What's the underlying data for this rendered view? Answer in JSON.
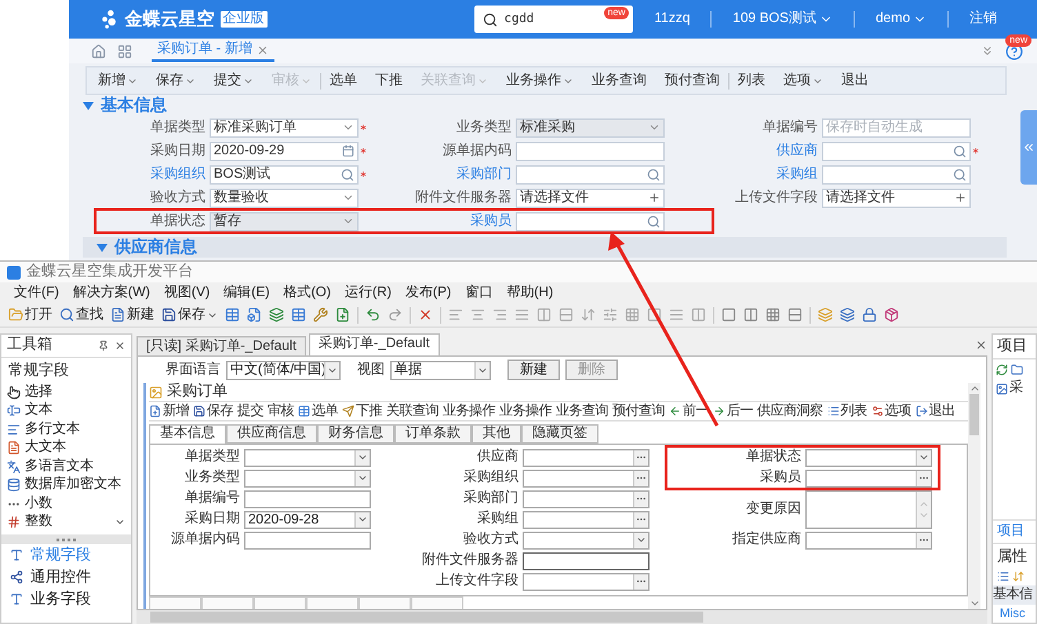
{
  "web": {
    "logo": "金蝶云星空",
    "edition": "企业版",
    "search": {
      "value": "cgdd",
      "badge": "new"
    },
    "header_items": [
      {
        "label": "11zzq",
        "dropdown": false
      },
      {
        "label": "109 BOS测试",
        "dropdown": true
      },
      {
        "label": "demo",
        "dropdown": true
      },
      {
        "label": "注销",
        "dropdown": false
      }
    ],
    "tabs": [
      {
        "label": "采购订单 - 新增",
        "selected": true
      }
    ],
    "help_badge": "new",
    "toolbar": [
      {
        "kind": "button",
        "label": "新增",
        "dropdown": true,
        "disabled": false
      },
      {
        "kind": "button",
        "label": "保存",
        "dropdown": true,
        "disabled": false
      },
      {
        "kind": "button",
        "label": "提交",
        "dropdown": true,
        "disabled": false
      },
      {
        "kind": "button",
        "label": "审核",
        "dropdown": true,
        "disabled": true
      },
      {
        "kind": "separator"
      },
      {
        "kind": "button",
        "label": "选单",
        "dropdown": false,
        "disabled": false
      },
      {
        "kind": "button",
        "label": "下推",
        "dropdown": false,
        "disabled": false
      },
      {
        "kind": "button",
        "label": "关联查询",
        "dropdown": true,
        "disabled": true
      },
      {
        "kind": "button",
        "label": "业务操作",
        "dropdown": true,
        "disabled": false
      },
      {
        "kind": "button",
        "label": "业务查询",
        "dropdown": false,
        "disabled": false
      },
      {
        "kind": "button",
        "label": "预付查询",
        "dropdown": false,
        "disabled": false
      },
      {
        "kind": "separator"
      },
      {
        "kind": "button",
        "label": "列表",
        "dropdown": false,
        "disabled": false
      },
      {
        "kind": "button",
        "label": "选项",
        "dropdown": true,
        "disabled": false
      },
      {
        "kind": "button",
        "label": "退出",
        "dropdown": false,
        "disabled": false
      }
    ],
    "sections": [
      {
        "title": "基本信息",
        "expanded": true,
        "rows": [
          {
            "highlighted": false,
            "fields": [
              {
                "label": "单据类型",
                "link": false,
                "kind": "select",
                "value": "标准采购订单",
                "required": true,
                "disabled": false
              },
              {
                "label": "业务类型",
                "link": false,
                "kind": "select",
                "value": "标准采购",
                "required": false,
                "disabled": true
              },
              {
                "label": "单据编号",
                "link": false,
                "kind": "text",
                "placeholder": "保存时自动生成",
                "required": false,
                "disabled": false
              }
            ]
          },
          {
            "highlighted": false,
            "fields": [
              {
                "label": "采购日期",
                "link": false,
                "kind": "date",
                "value": "2020-09-29",
                "required": true,
                "disabled": false
              },
              {
                "label": "源单据内码",
                "link": false,
                "kind": "text",
                "required": false,
                "disabled": false
              },
              {
                "label": "供应商",
                "link": true,
                "kind": "lookup",
                "required": true,
                "disabled": false
              }
            ]
          },
          {
            "highlighted": false,
            "fields": [
              {
                "label": "采购组织",
                "link": true,
                "kind": "lookup",
                "value": "BOS测试",
                "required": true,
                "disabled": false
              },
              {
                "label": "采购部门",
                "link": true,
                "kind": "lookup",
                "required": false,
                "disabled": false
              },
              {
                "label": "采购组",
                "link": true,
                "kind": "lookup",
                "required": false,
                "disabled": false
              }
            ]
          },
          {
            "highlighted": false,
            "fields": [
              {
                "label": "验收方式",
                "link": false,
                "kind": "select",
                "value": "数量验收",
                "required": false,
                "disabled": false
              },
              {
                "label": "附件文件服务器",
                "link": false,
                "kind": "file",
                "value": "请选择文件",
                "required": false,
                "disabled": false
              },
              {
                "label": "上传文件字段",
                "link": false,
                "kind": "file",
                "value": "请选择文件",
                "required": false,
                "disabled": false
              }
            ]
          },
          {
            "highlighted": true,
            "fields": [
              {
                "label": "单据状态",
                "link": false,
                "kind": "select",
                "value": "暂存",
                "required": false,
                "disabled": true
              },
              {
                "label": "采购员",
                "link": true,
                "kind": "lookup",
                "required": false,
                "disabled": false
              }
            ]
          }
        ]
      },
      {
        "title": "供应商信息",
        "expanded": true
      }
    ]
  },
  "ide": {
    "title": "金蝶云星空集成开发平台",
    "menu": [
      "文件(F)",
      "解决方案(W)",
      "视图(V)",
      "编辑(E)",
      "格式(O)",
      "运行(R)",
      "发布(P)",
      "窗口",
      "帮助(H)"
    ],
    "toolbar": [
      {
        "label": "打开",
        "dropdown": false
      },
      {
        "label": "查找",
        "dropdown": false
      },
      {
        "label": "新建",
        "dropdown": false
      },
      {
        "label": "保存",
        "dropdown": true
      }
    ],
    "toolbox": {
      "title": "工具箱",
      "group": "常规字段",
      "items": [
        "选择",
        "文本",
        "多行文本",
        "大文本",
        "多语言文本",
        "数据库加密文本",
        "小数",
        "整数"
      ],
      "categories": [
        {
          "label": "常规字段",
          "selected": true
        },
        {
          "label": "通用控件",
          "selected": false
        },
        {
          "label": "业务字段",
          "selected": false
        }
      ]
    },
    "doc_tabs": [
      {
        "label": "[只读] 采购订单-_Default",
        "selected": false
      },
      {
        "label": "采购订单-_Default",
        "selected": true
      }
    ],
    "options": {
      "language_label": "界面语言",
      "language": "中文(简体/中国)",
      "view_label": "视图",
      "view": "单据",
      "buttons": [
        {
          "label": "新建",
          "disabled": false
        },
        {
          "label": "删除",
          "disabled": true
        }
      ]
    },
    "designer": {
      "title": "采购订单",
      "toolbar": [
        {
          "label": "新增",
          "kind": "icon"
        },
        {
          "label": "保存",
          "kind": "icon"
        },
        {
          "label": "提交",
          "kind": "text"
        },
        {
          "label": "审核",
          "kind": "text"
        },
        {
          "label": "选单",
          "kind": "icon"
        },
        {
          "label": "下推",
          "kind": "icon"
        },
        {
          "label": "关联查询",
          "kind": "text"
        },
        {
          "label": "业务操作",
          "kind": "text"
        },
        {
          "label": "业务操作",
          "kind": "text"
        },
        {
          "label": "业务查询",
          "kind": "text"
        },
        {
          "label": "预付查询",
          "kind": "text"
        },
        {
          "label": "前一",
          "kind": "icon"
        },
        {
          "label": "后一",
          "kind": "icon"
        },
        {
          "label": "供应商洞察",
          "kind": "text"
        },
        {
          "label": "列表",
          "kind": "icon"
        },
        {
          "label": "选项",
          "kind": "icon"
        },
        {
          "label": "退出",
          "kind": "icon"
        }
      ],
      "tabs": [
        {
          "label": "基本信息",
          "selected": true
        },
        {
          "label": "供应商信息",
          "selected": false
        },
        {
          "label": "财务信息",
          "selected": false
        },
        {
          "label": "订单条款",
          "selected": false
        },
        {
          "label": "其他",
          "selected": false
        },
        {
          "label": "隐藏页签",
          "selected": false
        }
      ],
      "columns": [
        [
          {
            "label": "单据类型",
            "kind": "select",
            "highlighted": false
          },
          {
            "label": "业务类型",
            "kind": "select",
            "highlighted": false
          },
          {
            "label": "单据编号",
            "kind": "text",
            "highlighted": false
          },
          {
            "label": "采购日期",
            "kind": "select",
            "value": "2020-09-28",
            "highlighted": false
          },
          {
            "label": "源单据内码",
            "kind": "text",
            "highlighted": false
          }
        ],
        [
          {
            "label": "供应商",
            "kind": "lookup",
            "highlighted": false
          },
          {
            "label": "采购组织",
            "kind": "lookup",
            "highlighted": false
          },
          {
            "label": "采购部门",
            "kind": "lookup",
            "highlighted": false
          },
          {
            "label": "采购组",
            "kind": "lookup",
            "highlighted": false
          },
          {
            "label": "验收方式",
            "kind": "select",
            "highlighted": false
          },
          {
            "label": "附件文件服务器",
            "kind": "text",
            "highlighted": false
          },
          {
            "label": "上传文件字段",
            "kind": "lookup",
            "highlighted": false
          }
        ],
        [
          {
            "label": "单据状态",
            "kind": "select",
            "highlighted": true
          },
          {
            "label": "采购员",
            "kind": "lookup",
            "highlighted": true
          },
          {
            "label": "变更原因",
            "kind": "textarea",
            "highlighted": false
          },
          {
            "label": "指定供应商",
            "kind": "lookup",
            "highlighted": false
          }
        ]
      ]
    },
    "project": {
      "title": "项目",
      "tree_item": "采",
      "tab": "项目",
      "properties_title": "属性",
      "category": "基本信",
      "misc": "Misc"
    }
  }
}
